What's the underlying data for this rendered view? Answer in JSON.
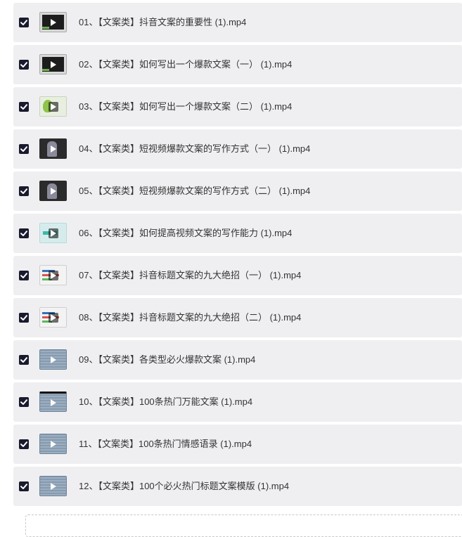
{
  "colors": {
    "row_background": "#efeff2",
    "checkbox": "#1a1a2e",
    "text": "#333333"
  },
  "items": [
    {
      "label": "01、【文案类】抖音文案的重要性 (1).mp4",
      "checked": true,
      "thumb": "dark"
    },
    {
      "label": "02、【文案类】如何写出一个爆款文案（一） (1).mp4",
      "checked": true,
      "thumb": "dark"
    },
    {
      "label": "03、【文案类】如何写出一个爆款文案（二） (1).mp4",
      "checked": true,
      "thumb": "green"
    },
    {
      "label": "04、【文案类】短视频爆款文案的写作方式（一） (1).mp4",
      "checked": true,
      "thumb": "person"
    },
    {
      "label": "05、【文案类】短视频爆款文案的写作方式（二） (1).mp4",
      "checked": true,
      "thumb": "person"
    },
    {
      "label": "06、【文案类】如何提高视频文案的写作能力 (1).mp4",
      "checked": true,
      "thumb": "cyan"
    },
    {
      "label": "07、【文案类】抖音标题文案的九大绝招（一） (1).mp4",
      "checked": true,
      "thumb": "doc"
    },
    {
      "label": "08、【文案类】抖音标题文案的九大绝招（二） (1).mp4",
      "checked": true,
      "thumb": "doc"
    },
    {
      "label": "09、【文案类】各类型必火爆款文案 (1).mp4",
      "checked": true,
      "thumb": "blue"
    },
    {
      "label": "10、【文案类】100条热门万能文案 (1).mp4",
      "checked": true,
      "thumb": "blue-top"
    },
    {
      "label": "11、【文案类】100条热门情感语录 (1).mp4",
      "checked": true,
      "thumb": "blue"
    },
    {
      "label": "12、【文案类】100个必火热门标题文案模版 (1).mp4",
      "checked": true,
      "thumb": "blue"
    }
  ]
}
